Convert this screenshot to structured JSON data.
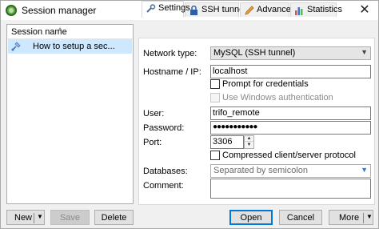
{
  "window": {
    "title": "Session manager",
    "close_glyph": "✕"
  },
  "session_list": {
    "column_header": "Session name",
    "sort_glyph": "^",
    "items": [
      {
        "label": "How to setup a sec..."
      }
    ]
  },
  "tabs": [
    {
      "label": "Settings",
      "icon": "wrench-icon",
      "active": true
    },
    {
      "label": "SSH tunnel",
      "icon": "lock-icon"
    },
    {
      "label": "Advanced",
      "icon": "pencil-icon"
    },
    {
      "label": "Statistics",
      "icon": "bar-chart-icon"
    }
  ],
  "settings": {
    "network_type": {
      "label": "Network type:",
      "value": "MySQL (SSH tunnel)"
    },
    "hostname": {
      "label": "Hostname / IP:",
      "value": "localhost"
    },
    "prompt_credentials": {
      "label": "Prompt for credentials",
      "checked": false
    },
    "windows_auth": {
      "label": "Use Windows authentication",
      "checked": false,
      "disabled": true
    },
    "user": {
      "label": "User:",
      "value": "trifo_remote"
    },
    "password": {
      "label": "Password:",
      "value": "●●●●●●●●●●●"
    },
    "port": {
      "label": "Port:",
      "value": "3306"
    },
    "compressed": {
      "label": "Compressed client/server protocol",
      "checked": false
    },
    "databases": {
      "label": "Databases:",
      "placeholder": "Separated by semicolon"
    },
    "comment": {
      "label": "Comment:",
      "value": ""
    }
  },
  "buttons": {
    "new": "New",
    "save": "Save",
    "delete": "Delete",
    "open": "Open",
    "cancel": "Cancel",
    "more": "More",
    "dropdown_glyph": "▼"
  },
  "colors": {
    "selection": "#cde8ff",
    "accent": "#0078d7"
  }
}
